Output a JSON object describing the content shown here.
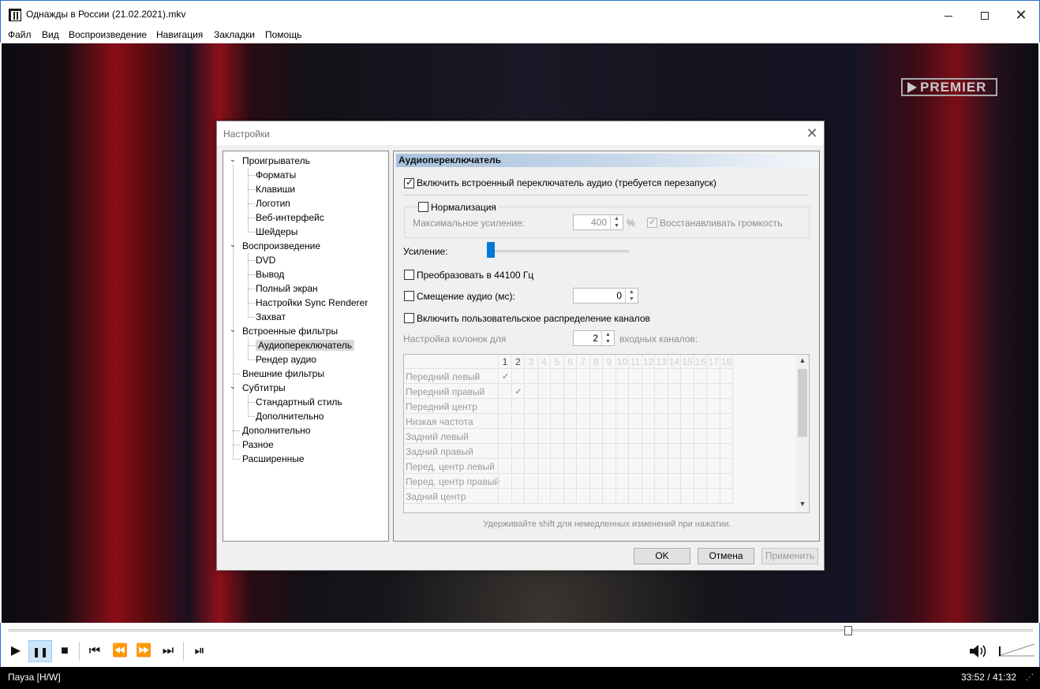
{
  "window": {
    "title": "Однажды в России (21.02.2021).mkv",
    "minimize_icon": "minimize-icon",
    "maximize_icon": "maximize-icon",
    "close_glyph": "✕"
  },
  "menu": {
    "items": [
      "Файл",
      "Вид",
      "Воспроизведение",
      "Навигация",
      "Закладки",
      "Помощь"
    ]
  },
  "video": {
    "watermark": "PREMIER"
  },
  "dialog": {
    "title": "Настройки",
    "close_glyph": "✕",
    "tree": [
      {
        "label": "Проигрыватель",
        "level": 0,
        "expanded": true
      },
      {
        "label": "Форматы",
        "level": 1
      },
      {
        "label": "Клавиши",
        "level": 1
      },
      {
        "label": "Логотип",
        "level": 1
      },
      {
        "label": "Веб-интерфейс",
        "level": 1
      },
      {
        "label": "Шейдеры",
        "level": 1
      },
      {
        "label": "Воспроизведение",
        "level": 0,
        "expanded": true
      },
      {
        "label": "DVD",
        "level": 1
      },
      {
        "label": "Вывод",
        "level": 1
      },
      {
        "label": "Полный экран",
        "level": 1
      },
      {
        "label": "Настройки Sync Renderer",
        "level": 1
      },
      {
        "label": "Захват",
        "level": 1
      },
      {
        "label": "Встроенные фильтры",
        "level": 0,
        "expanded": true
      },
      {
        "label": "Аудиопереключатель",
        "level": 1,
        "selected": true
      },
      {
        "label": "Рендер аудио",
        "level": 1
      },
      {
        "label": "Внешние фильтры",
        "level": 0
      },
      {
        "label": "Субтитры",
        "level": 0,
        "expanded": true
      },
      {
        "label": "Стандартный стиль",
        "level": 1
      },
      {
        "label": "Дополнительно",
        "level": 1
      },
      {
        "label": "Дополнительно",
        "level": 0
      },
      {
        "label": "Разное",
        "level": 0
      },
      {
        "label": "Расширенные",
        "level": 0
      }
    ],
    "panel": {
      "header": "Аудиопереключатель",
      "enable_switcher": {
        "label": "Включить встроенный переключатель аудио (требуется перезапуск)",
        "checked": true
      },
      "normalization": {
        "label": "Нормализация",
        "checked": false
      },
      "max_gain": {
        "label": "Максимальное усиление:",
        "value": "400",
        "unit": "%"
      },
      "restore_volume": {
        "label": "Восстанавливать громкость",
        "checked": true
      },
      "gain": {
        "label": "Усиление:",
        "level": 0.0
      },
      "convert_44100": {
        "label": "Преобразовать в 44100 Гц",
        "checked": false
      },
      "audio_offset": {
        "label": "Смещение аудио (мс):",
        "value": "0",
        "checked": false
      },
      "custom_channels": {
        "label": "Включить пользовательское распределение каналов",
        "checked": false
      },
      "speaker_config": {
        "label_before": "Настройка колонок для",
        "value": "2",
        "label_after": "входных каналов:"
      },
      "channel_grid": {
        "columns": [
          "1",
          "2",
          "3",
          "4",
          "5",
          "6",
          "7",
          "8",
          "9",
          "10",
          "11",
          "12",
          "13",
          "14",
          "15",
          "16",
          "17",
          "18"
        ],
        "rows": [
          {
            "label": "Передний левый",
            "checked_column": "1"
          },
          {
            "label": "Передний правый",
            "checked_column": "2"
          },
          {
            "label": "Передний центр",
            "checked_column": ""
          },
          {
            "label": "Низкая частота",
            "checked_column": ""
          },
          {
            "label": "Задний левый",
            "checked_column": ""
          },
          {
            "label": "Задний правый",
            "checked_column": ""
          },
          {
            "label": "Перед. центр левый",
            "checked_column": ""
          },
          {
            "label": "Перед. центр правый",
            "checked_column": ""
          },
          {
            "label": "Задний центр",
            "checked_column": ""
          }
        ]
      },
      "hint": "Удерживайте shift для немедленных изменений при нажатии."
    },
    "buttons": {
      "ok": "OK",
      "cancel": "Отмена",
      "apply": "Применить"
    }
  },
  "controls": {
    "seek_position": 0.8199,
    "play": "▶",
    "pause": "❚❚",
    "stop": "■",
    "prev": "⏮",
    "rewind": "⏪",
    "forward": "⏩",
    "next": "⏭",
    "frame_step": "⏯",
    "volume_icon": "speaker-icon"
  },
  "status": {
    "state": "Пауза [H/W]",
    "time": "33:52 / 41:32"
  }
}
